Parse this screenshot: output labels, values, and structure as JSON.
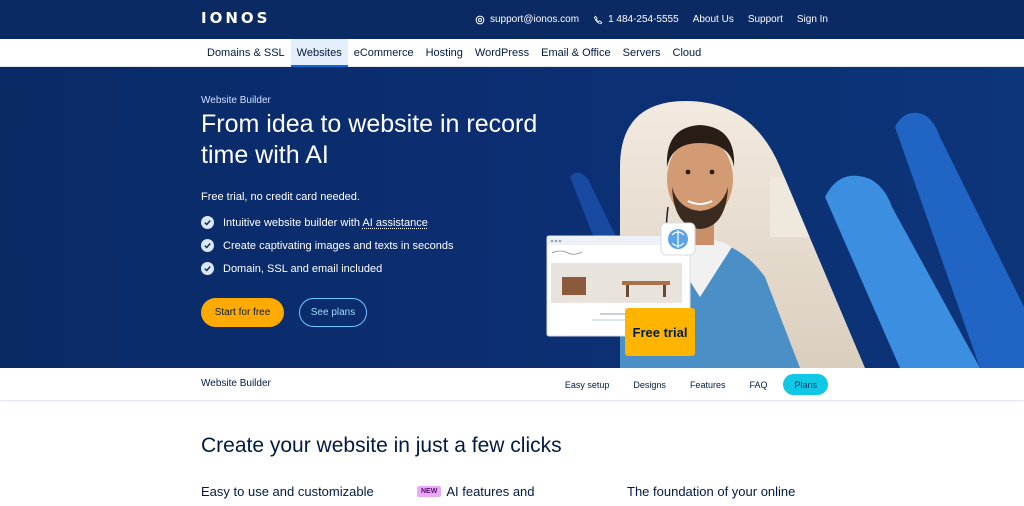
{
  "brand": {
    "logo": "IONOS"
  },
  "topbar": {
    "email": "support@ionos.com",
    "phone": "1 484-254-5555",
    "about": "About Us",
    "support": "Support",
    "signin": "Sign In"
  },
  "nav": {
    "items": [
      "Domains & SSL",
      "Websites",
      "eCommerce",
      "Hosting",
      "WordPress",
      "Email & Office",
      "Servers",
      "Cloud"
    ],
    "active": "Websites"
  },
  "hero": {
    "eyebrow": "Website Builder",
    "title": "From idea to website in record time with AI",
    "subtitle": "Free trial, no credit card needed.",
    "features": [
      {
        "before": "Intuitive website builder with ",
        "link": "AI assistance"
      },
      {
        "before": "Create captivating images and texts in seconds",
        "link": ""
      },
      {
        "before": "Domain, SSL and email included",
        "link": ""
      }
    ],
    "primary_cta": "Start for free",
    "secondary_cta": "See plans",
    "badge": "Free trial"
  },
  "subnav": {
    "title": "Website Builder",
    "links": [
      "Easy setup",
      "Designs",
      "Features",
      "FAQ"
    ],
    "plans": "Plans"
  },
  "content": {
    "title": "Create your website in just a few clicks",
    "columns": [
      {
        "text": "Easy to use and customizable",
        "badge": ""
      },
      {
        "text": "AI features and",
        "badge": "NEW"
      },
      {
        "text": "The foundation of your online",
        "badge": ""
      }
    ]
  },
  "colors": {
    "topbar": "#0b2a63",
    "hero_bg": "#0c2f73",
    "cta_primary": "#ffaa00",
    "plans_pill": "#11c7e6",
    "badge": "#ffb400"
  }
}
